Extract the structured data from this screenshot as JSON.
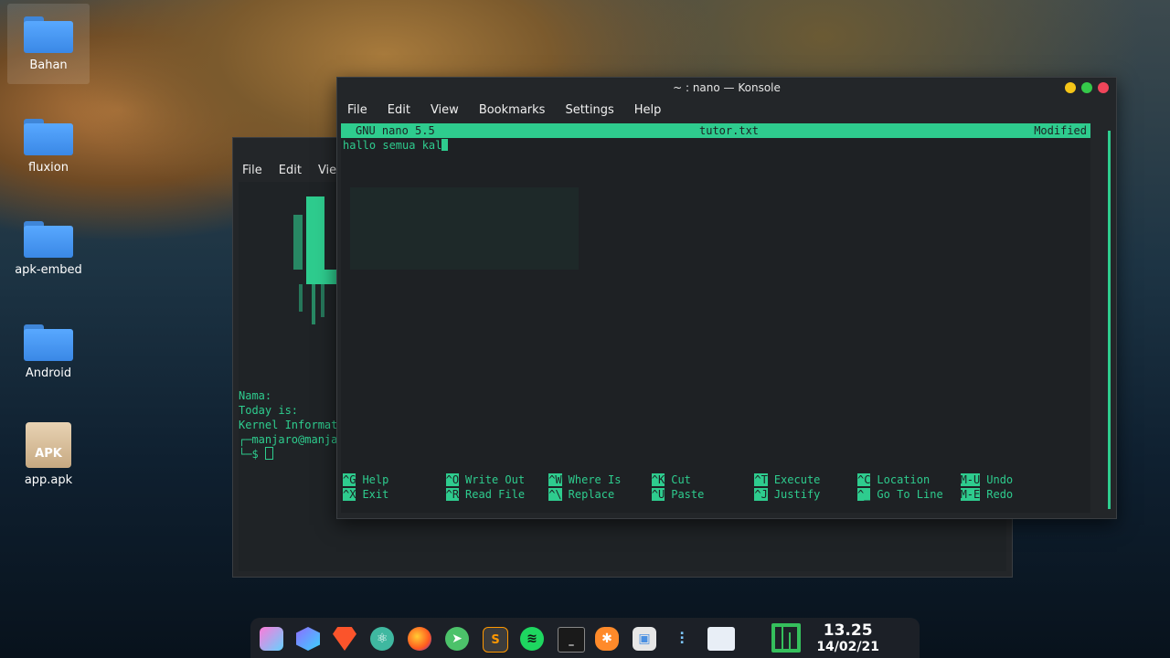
{
  "desktop": {
    "icons": [
      {
        "label": "Bahan"
      },
      {
        "label": "fluxion"
      },
      {
        "label": "apk-embed"
      },
      {
        "label": "Android"
      },
      {
        "label": "app.apk",
        "badge": "APK"
      }
    ]
  },
  "back_window": {
    "menu": [
      "File",
      "Edit",
      "View"
    ],
    "lines": [
      "Nama:",
      "Today is:",
      "Kernel Informat",
      "┌─manjaro@manja",
      "└─$ "
    ]
  },
  "front_window": {
    "title": "~ : nano — Konsole",
    "menu": [
      "File",
      "Edit",
      "View",
      "Bookmarks",
      "Settings",
      "Help"
    ],
    "nano": {
      "version": "GNU nano 5.5",
      "filename": "tutor.txt",
      "status": "Modified",
      "content": "hallo semua kal",
      "shortcuts": [
        {
          "key": "^G",
          "label": "Help"
        },
        {
          "key": "^O",
          "label": "Write Out"
        },
        {
          "key": "^W",
          "label": "Where Is"
        },
        {
          "key": "^K",
          "label": "Cut"
        },
        {
          "key": "^T",
          "label": "Execute"
        },
        {
          "key": "^C",
          "label": "Location"
        },
        {
          "key": "M-U",
          "label": "Undo"
        },
        {
          "key": "^X",
          "label": "Exit"
        },
        {
          "key": "^R",
          "label": "Read File"
        },
        {
          "key": "^\\",
          "label": "Replace"
        },
        {
          "key": "^U",
          "label": "Paste"
        },
        {
          "key": "^J",
          "label": "Justify"
        },
        {
          "key": "^_",
          "label": "Go To Line"
        },
        {
          "key": "M-E",
          "label": "Redo"
        }
      ]
    }
  },
  "dock": {
    "icons": [
      "cube-icon",
      "hexagon-icon",
      "brave-icon",
      "atom-icon",
      "firefox-icon",
      "telegram-icon",
      "sublime-icon",
      "spotify-icon",
      "terminal-icon",
      "pinwheel-icon",
      "store-icon",
      "mixer-icon",
      "files-icon"
    ],
    "sublime_letter": "S",
    "clock_time": "13.25",
    "clock_date": "14/02/21"
  },
  "colors": {
    "accent": "#2ecc8e",
    "window_bg": "#232629",
    "folder": "#4a9cf3"
  }
}
